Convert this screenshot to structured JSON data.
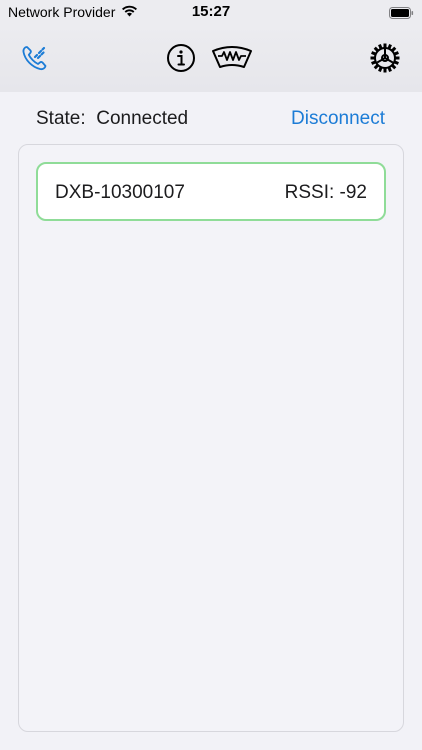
{
  "status_bar": {
    "carrier": "Network Provider",
    "time": "15:27"
  },
  "toolbar": {
    "icons": [
      "phone-signal-icon",
      "info-icon",
      "meter-icon",
      "settings-gear-icon"
    ],
    "accent_color": "#1c7cd6"
  },
  "connection": {
    "state_label": "State:",
    "state_value": "Connected",
    "action_label": "Disconnect"
  },
  "devices": [
    {
      "name": "DXB-10300107",
      "rssi_label": "RSSI:",
      "rssi_value": "-92",
      "border_color": "#8fdc98"
    }
  ]
}
